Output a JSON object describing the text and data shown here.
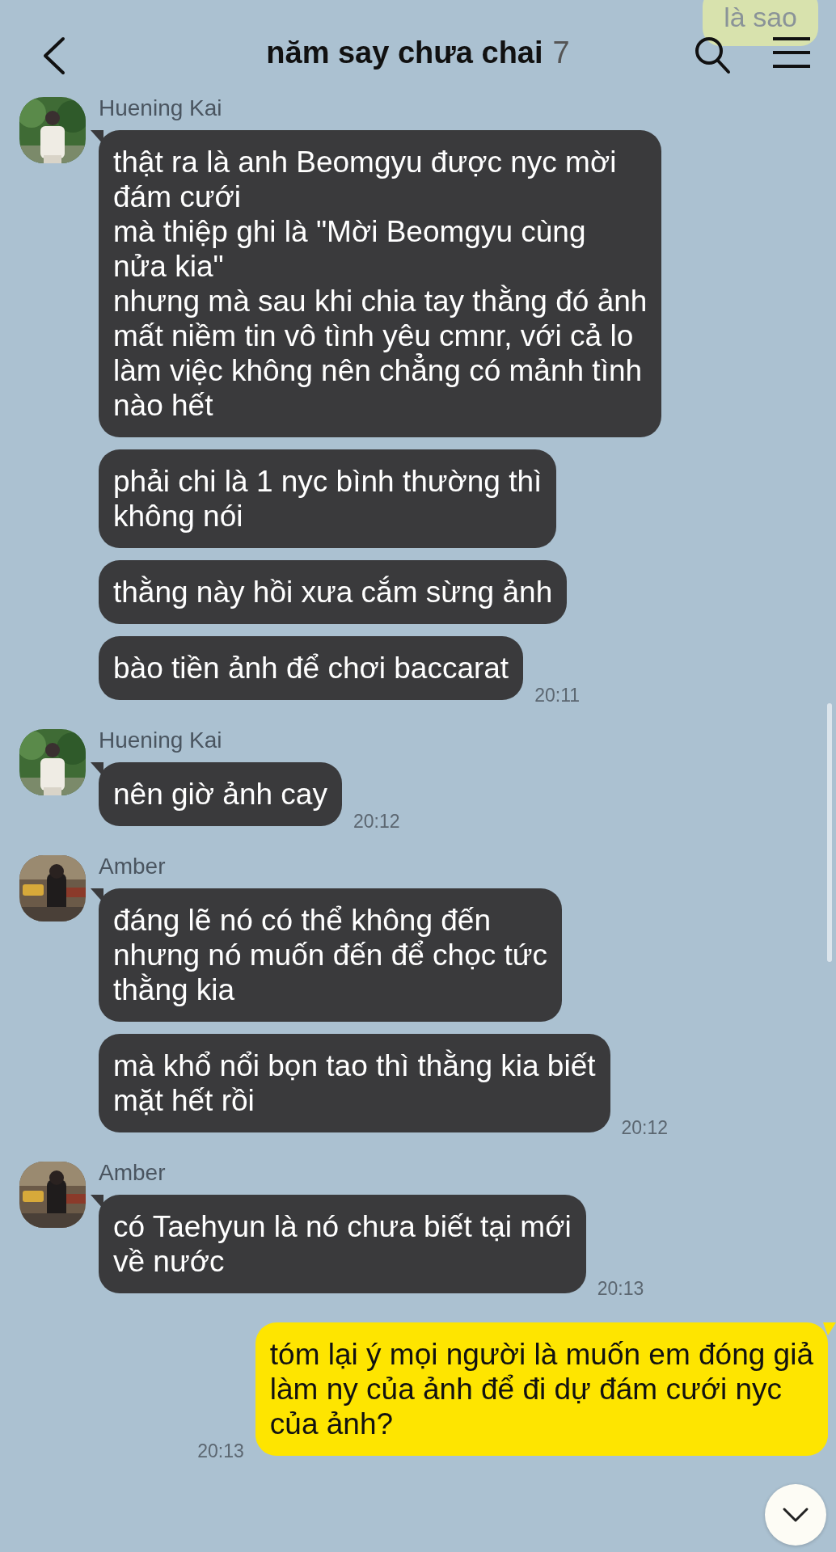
{
  "header": {
    "title": "năm say chưa chai",
    "member_count": "7"
  },
  "faded_message": {
    "text": "là sao"
  },
  "groups": [
    {
      "mine": false,
      "sender": "Huening Kai",
      "avatar": {
        "kind": "picture"
      },
      "time": "20:11",
      "messages": [
        "thật ra là anh Beomgyu được nyc mời\nđám cưới\nmà thiệp ghi là \"Mời Beomgyu cùng\nnửa kia\"\nnhưng mà sau khi chia tay thằng đó ảnh\nmất niềm tin vô tình yêu cmnr, với cả lo\nlàm việc không nên chẳng có mảnh tình\nnào hết",
        "phải chi là 1 nyc bình thường thì\nkhông nói",
        "thằng này hồi xưa cắm sừng ảnh",
        "bào tiền ảnh để chơi baccarat"
      ]
    },
    {
      "mine": false,
      "sender": "Huening Kai",
      "avatar": {
        "kind": "picture"
      },
      "time": "20:12",
      "messages": [
        "nên giờ ảnh cay"
      ]
    },
    {
      "mine": false,
      "sender": "Amber",
      "avatar": {
        "kind": "picture"
      },
      "time": "20:12",
      "messages": [
        "đáng lẽ nó có thể không đến\nnhưng nó muốn đến để chọc tức\nthằng kia",
        "mà khổ nổi bọn tao thì thằng kia biết\nmặt hết rồi"
      ]
    },
    {
      "mine": false,
      "sender": "Amber",
      "avatar": {
        "kind": "picture"
      },
      "time": "20:13",
      "messages": [
        "có Taehyun là nó chưa biết tại mới\nvề nước"
      ]
    },
    {
      "mine": true,
      "time": "20:13",
      "messages": [
        "tóm lại ý mọi người là muốn em đóng giả\nlàm ny của ảnh để đi dự đám cưới nyc\ncủa ảnh?"
      ]
    }
  ]
}
